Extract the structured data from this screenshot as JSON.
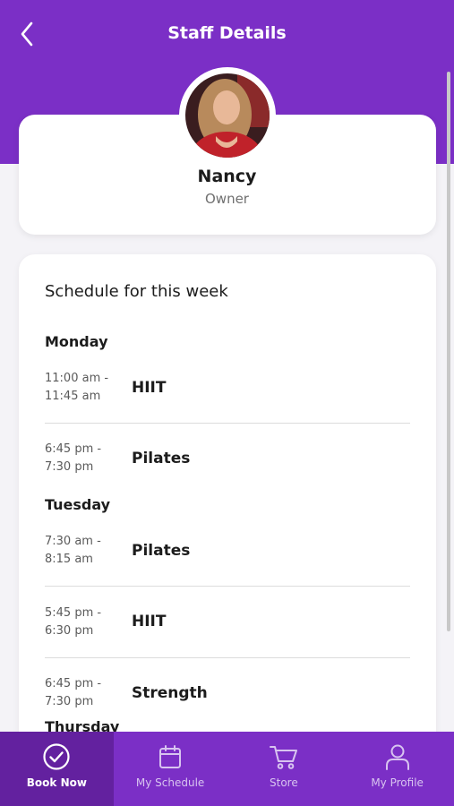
{
  "header": {
    "title": "Staff Details"
  },
  "profile": {
    "name": "Nancy",
    "role": "Owner"
  },
  "schedule": {
    "heading": "Schedule for this week",
    "days": [
      {
        "day": "Monday",
        "sessions": [
          {
            "time_start": "11:00 am -",
            "time_end": "11:45 am",
            "class": "HIIT"
          },
          {
            "time_start": "6:45 pm -",
            "time_end": "7:30 pm",
            "class": "Pilates"
          }
        ]
      },
      {
        "day": "Tuesday",
        "sessions": [
          {
            "time_start": "7:30 am -",
            "time_end": "8:15 am",
            "class": "Pilates"
          },
          {
            "time_start": "5:45 pm -",
            "time_end": "6:30 pm",
            "class": "HIIT"
          },
          {
            "time_start": "6:45 pm -",
            "time_end": "7:30 pm",
            "class": "Strength"
          }
        ]
      },
      {
        "day": "Thursday",
        "sessions": []
      }
    ]
  },
  "tabs": [
    {
      "label": "Book Now",
      "icon": "check-circle-icon",
      "active": true
    },
    {
      "label": "My Schedule",
      "icon": "calendar-icon",
      "active": false
    },
    {
      "label": "Store",
      "icon": "cart-icon",
      "active": false
    },
    {
      "label": "My Profile",
      "icon": "person-icon",
      "active": false
    }
  ],
  "colors": {
    "brand": "#7b2fc6",
    "brand_dark": "#63219f"
  }
}
